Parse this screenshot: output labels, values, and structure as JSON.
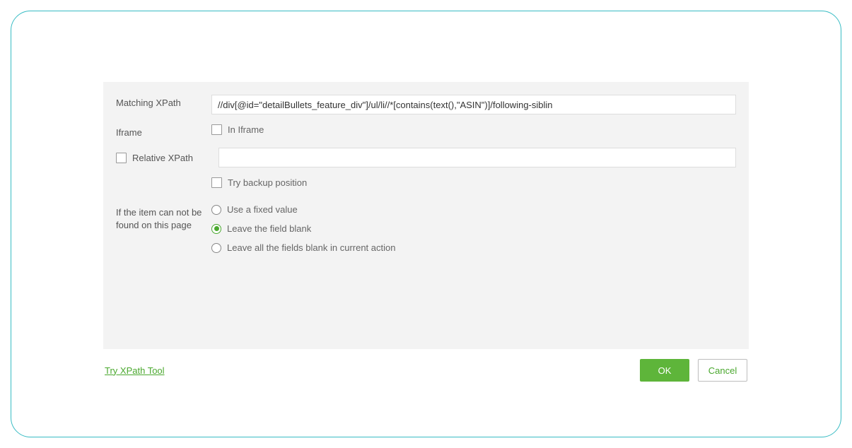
{
  "form": {
    "matching_xpath": {
      "label": "Matching XPath",
      "value": "//div[@id=\"detailBullets_feature_div\"]/ul/li//*[contains(text(),\"ASIN\")]/following-siblin"
    },
    "iframe": {
      "label": "Iframe",
      "checkbox_label": "In Iframe",
      "checked": false
    },
    "relative_xpath": {
      "checkbox_label": "Relative XPath",
      "checked": false,
      "value": ""
    },
    "backup": {
      "checkbox_label": "Try backup position",
      "checked": false
    },
    "not_found": {
      "label_line1": "If the item can not be",
      "label_line2": "found on this page",
      "options": [
        {
          "label": "Use a fixed value",
          "selected": false
        },
        {
          "label": "Leave the field blank",
          "selected": true
        },
        {
          "label": "Leave all the fields blank in current action",
          "selected": false
        }
      ]
    }
  },
  "footer": {
    "link_label": "Try XPath Tool",
    "ok_label": "OK",
    "cancel_label": "Cancel"
  }
}
